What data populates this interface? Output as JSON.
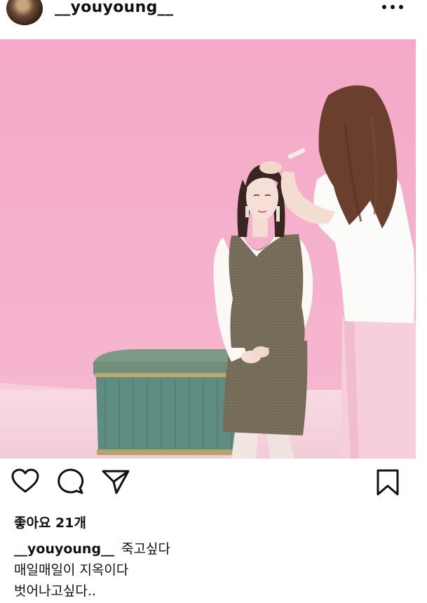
{
  "post": {
    "username": "__youyoung__",
    "likes_text": "좋아요 21개",
    "caption": {
      "username": "__youyoung__",
      "lines": [
        "죽고싶다",
        "매일매일이 지옥이다",
        "벗어나고싶다.."
      ]
    }
  },
  "icons": {
    "more": "more-dots-icon",
    "like": "heart-icon",
    "comment": "comment-bubble-icon",
    "share": "paper-plane-icon",
    "save": "bookmark-icon"
  }
}
